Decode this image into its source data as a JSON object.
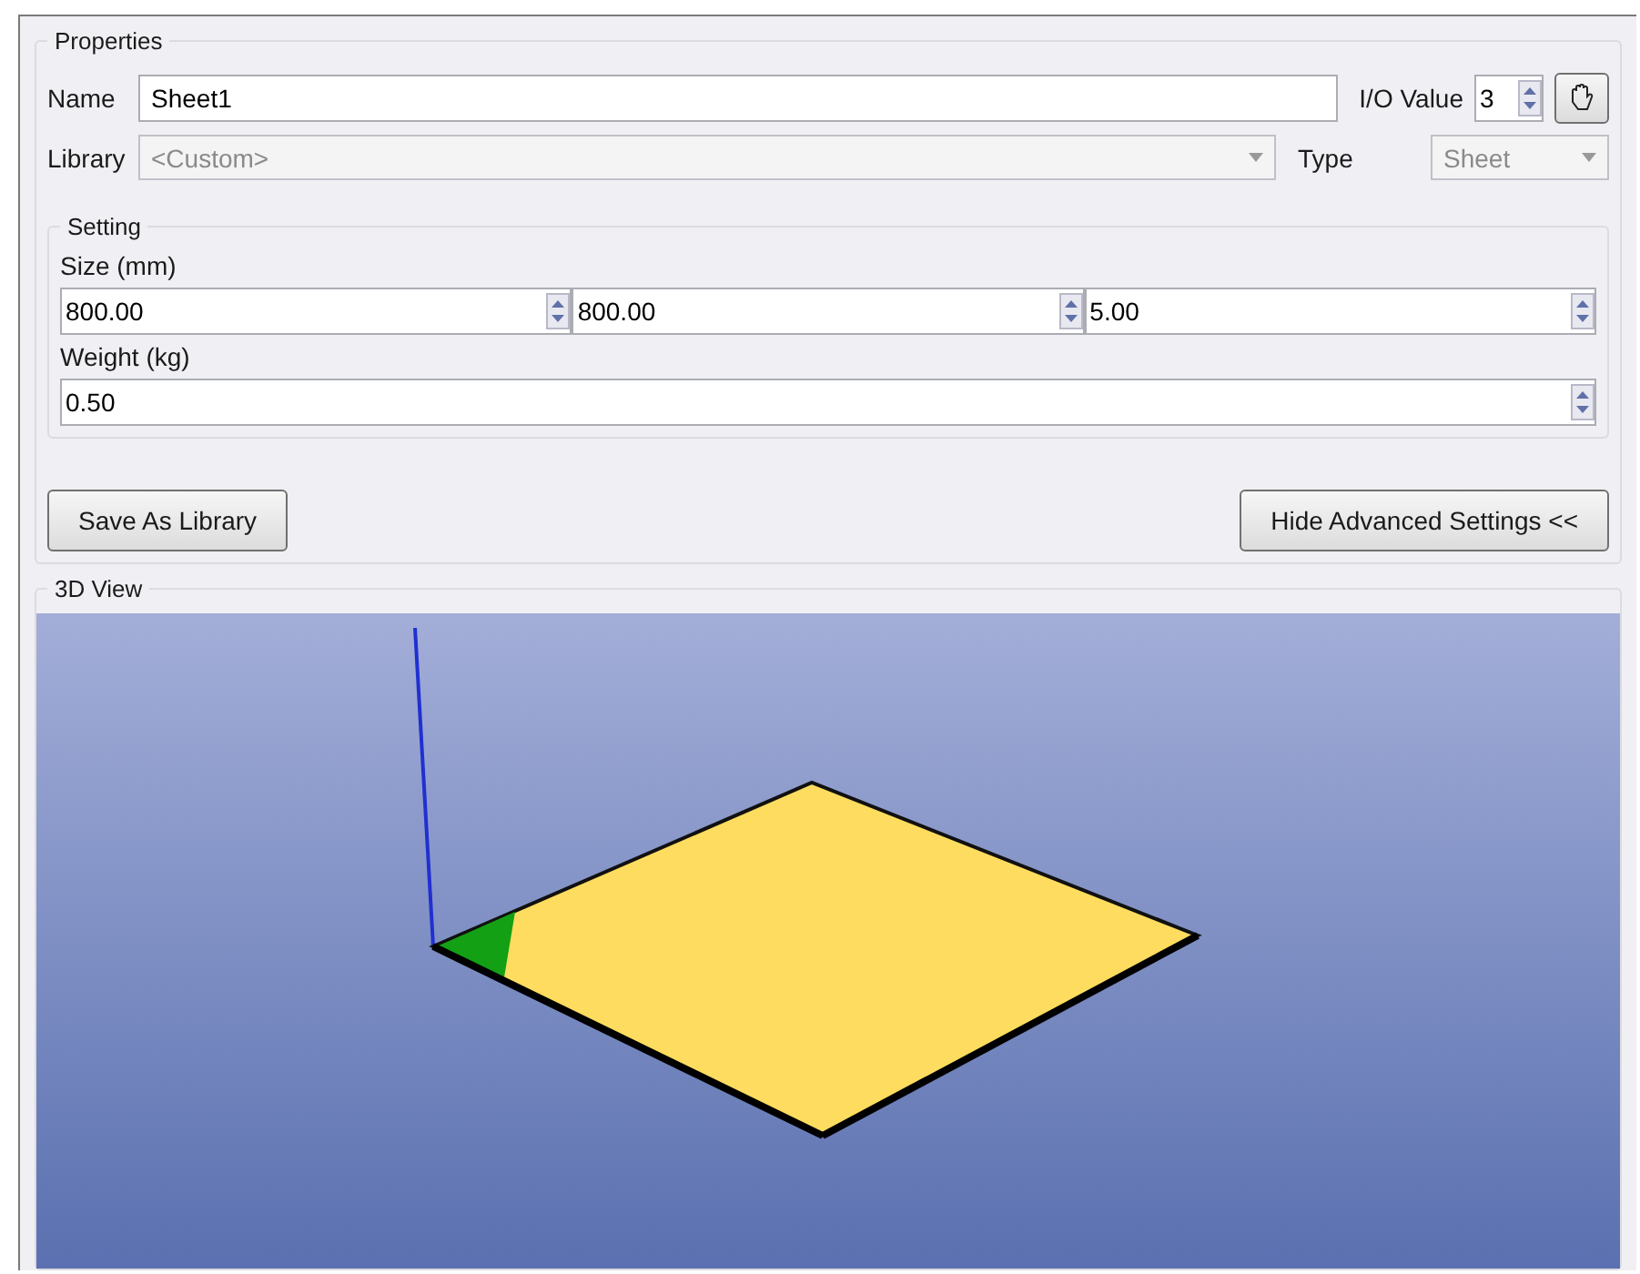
{
  "properties": {
    "title": "Properties",
    "name": {
      "label": "Name",
      "value": "Sheet1"
    },
    "io_value": {
      "label": "I/O Value",
      "value": "3"
    },
    "library": {
      "label": "Library",
      "value": "<Custom>",
      "disabled": true
    },
    "type": {
      "label": "Type",
      "value": "Sheet",
      "disabled": true
    },
    "setting": {
      "title": "Setting",
      "size": {
        "label": "Size (mm)",
        "values": [
          "800.00",
          "800.00",
          "5.00"
        ]
      },
      "weight": {
        "label": "Weight (kg)",
        "value": "0.50"
      }
    },
    "buttons": [
      "Save As Library",
      "Hide Advanced Settings <<"
    ]
  },
  "view": {
    "title": "3D View"
  }
}
